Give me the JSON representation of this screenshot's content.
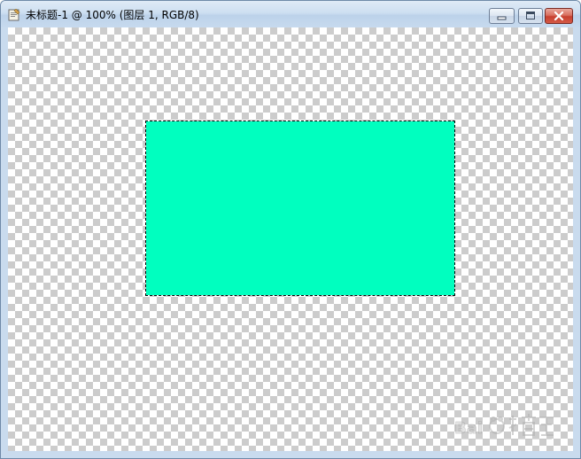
{
  "window": {
    "title": "未标题-1 @ 100% (图层 1, RGB/8)",
    "icon": "document-icon"
  },
  "controls": {
    "minimize": "minimize-icon",
    "maximize": "maximize-icon",
    "close": "close-icon"
  },
  "canvas": {
    "background": "transparency-checkerboard",
    "shape_color": "#00FFBF",
    "selection": "marching-ants"
  },
  "watermark": {
    "logo": "Baidu 经验 logo"
  }
}
